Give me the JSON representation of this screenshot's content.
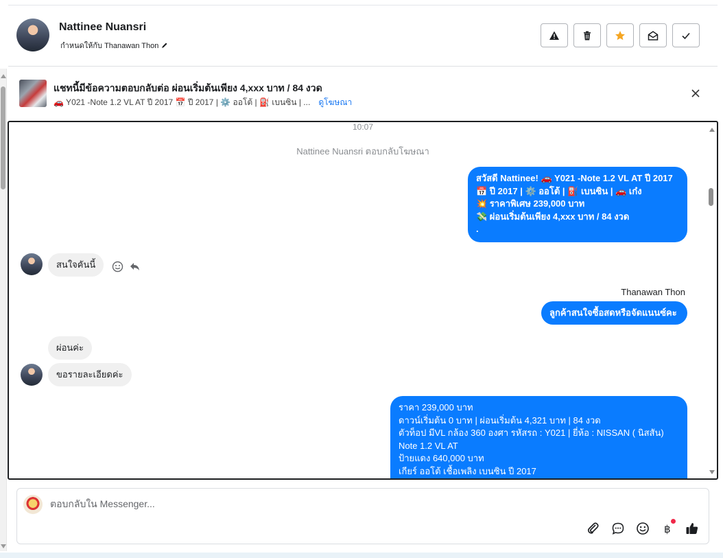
{
  "header": {
    "name": "Nattinee Nuansri",
    "assigned": "กำหนดให้กับ Thanawan Thon",
    "actions": [
      {
        "id": "report",
        "icon": "warning-icon"
      },
      {
        "id": "delete",
        "icon": "trash-icon"
      },
      {
        "id": "star",
        "icon": "star-icon"
      },
      {
        "id": "mark-unread",
        "icon": "envelope-open-icon"
      },
      {
        "id": "done",
        "icon": "check-icon"
      }
    ],
    "star_color": "#f5a623"
  },
  "ad": {
    "title": "แชทนี้มีข้อความตอบกลับต่อ ผ่อนเริ่มต้นเพียง 4,xxx บาท / 84 งวด",
    "subtitle": "🚗 Y021 -Note 1.2 VL AT ปี 2017 📅 ปี 2017 | ⚙️ ออโต้ | ⛽ เบนซิน | ...",
    "link": "ดูโฆษณา"
  },
  "chat": {
    "time": "10:07",
    "system_note": "Nattinee Nuansri ตอบกลับโฆษณา",
    "messages": {
      "out1": "สวัสดี Nattinee! 🚗 Y021 -Note 1.2 VL AT ปี 2017\n📅 ปี 2017 | ⚙️ ออโต้ | ⛽ เบนซิน | 🚗 เก๋ง\n💥 ราคาพิเศษ 239,000 บาท\n💸 ผ่อนเริ่มต้นเพียง 4,xxx บาท / 84 งวด\n.",
      "in1": "สนใจคันนี้",
      "sender2": "Thanawan Thon",
      "out2": "ลูกค้าสนใจซื้อสดหรือจัดแนนซ์คะ",
      "in2": "ผ่อนค่ะ",
      "in3": "ขอรายละเอียดค่ะ",
      "out3": "ราคา 239,000 บาท\nดาวน์เริ่มต้น 0 บาท | ผ่อนเริ่มต้น 4,321 บาท | 84 งวด\n ตัวท็อป มีVL กล้อง 360 องศา  รหัสรถ : Y021 |  ยี่ห้อ : NISSAN ( นิสสัน)\nNote 1.2 VL AT\n ป้ายแดง 640,000 บาท\n เกียร์ ออโต้  เชื้อเพลิง เบนซิน  ปี 2017"
    },
    "bubble_color": "#0a7cff"
  },
  "composer": {
    "placeholder": "ตอบกลับใน Messenger...",
    "tools": [
      "paperclip-icon",
      "chat-bubble-icon",
      "emoji-icon",
      "baht-icon",
      "thumbs-up-icon"
    ]
  }
}
